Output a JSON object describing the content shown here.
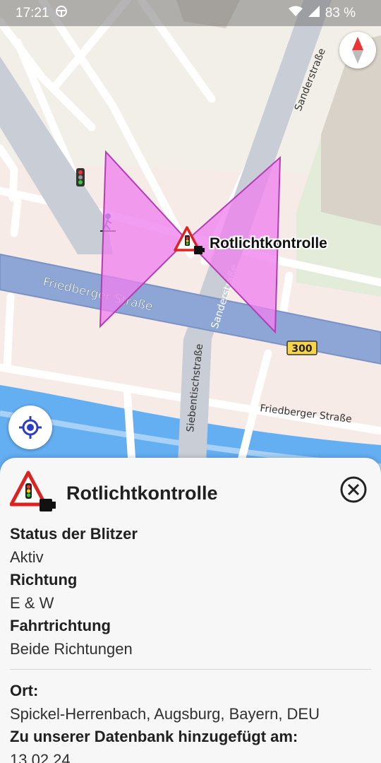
{
  "status_bar": {
    "time": "17:21",
    "battery": "83 %"
  },
  "map": {
    "streets": {
      "sanderstrasse_top": "Sanderstraße",
      "sanderstrasse_mid": "Sanderstraße",
      "friedberger_main": "Friedberger Straße",
      "friedberger_lower": "Friedberger Straße",
      "siebentisch": "Siebentischstraße"
    },
    "road_shield": "300",
    "marker_label": "Rotlichtkontrolle",
    "zone_color": "#ee82ee",
    "road_color": "#8ea6d6",
    "water_color": "#64aef2"
  },
  "sheet": {
    "title": "Rotlichtkontrolle",
    "fields": [
      {
        "label": "Status der Blitzer",
        "value": "Aktiv"
      },
      {
        "label": "Richtung",
        "value": "E & W"
      },
      {
        "label": "Fahrtrichtung",
        "value": "Beide Richtungen"
      }
    ],
    "location": {
      "label": "Ort:",
      "value": "Spickel-Herrenbach, Augsburg, Bayern, DEU"
    },
    "added": {
      "label": "Zu unserer Datenbank hinzugefügt am:",
      "value": "13.02.24"
    }
  }
}
